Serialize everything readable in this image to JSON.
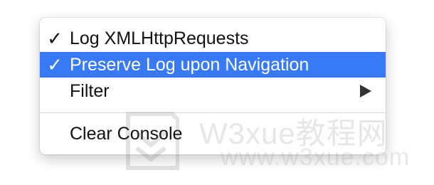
{
  "menu": {
    "items": [
      {
        "label": "Log XMLHttpRequests",
        "checked": "✓"
      },
      {
        "label": "Preserve Log upon Navigation",
        "checked": "✓"
      },
      {
        "label": "Filter",
        "checked": ""
      },
      {
        "label": "Clear Console",
        "checked": ""
      }
    ],
    "highlight_color": "#3879f5",
    "submenu_icon": "triangle-right-icon"
  },
  "watermark": {
    "line1": "W3xue教程网",
    "line2": "www.w3xue.com"
  }
}
